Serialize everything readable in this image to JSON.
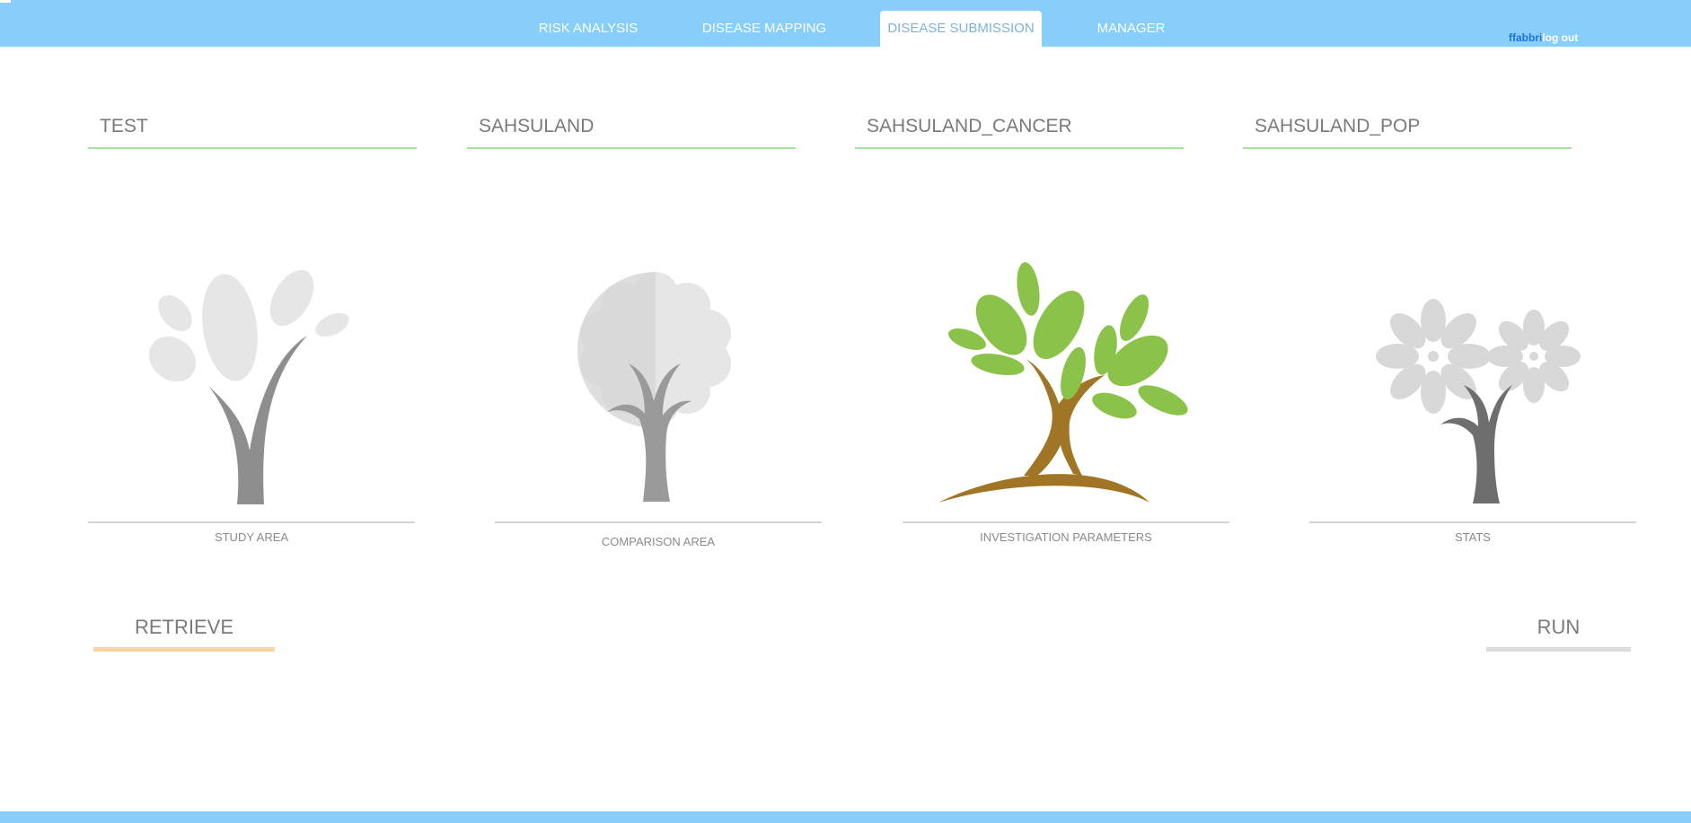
{
  "nav": {
    "tabs": [
      {
        "label": "RISK ANALYSIS",
        "active": false
      },
      {
        "label": "DISEASE MAPPING",
        "active": false
      },
      {
        "label": "DISEASE SUBMISSION",
        "active": true
      },
      {
        "label": "MANAGER",
        "active": false
      }
    ],
    "user": {
      "name": "ffabbri",
      "logout_label": "log out"
    }
  },
  "fields": [
    {
      "value": "TEST"
    },
    {
      "value": "SAHSULAND"
    },
    {
      "value": "SAHSULAND_CANCER"
    },
    {
      "value": "SAHSULAND_POP"
    }
  ],
  "steps": [
    {
      "label": "STUDY AREA",
      "icon": "tree-leaves-icon",
      "state": "inactive"
    },
    {
      "label": "COMPARISON AREA",
      "icon": "tree-round-icon",
      "state": "inactive"
    },
    {
      "label": "INVESTIGATION PARAMETERS",
      "icon": "tree-green-icon",
      "state": "active"
    },
    {
      "label": "STATS",
      "icon": "tree-flowers-icon",
      "state": "inactive"
    }
  ],
  "actions": {
    "retrieve_label": "RETRIEVE",
    "run_label": "RUN"
  },
  "colors": {
    "topbar": "#87cefa",
    "field_underline": "#a6e3a0",
    "retrieve_underline": "#ffd3a6",
    "run_underline": "#dcdcdc",
    "tree_active_leaves": "#8bc34a",
    "tree_active_trunk": "#a07526"
  }
}
